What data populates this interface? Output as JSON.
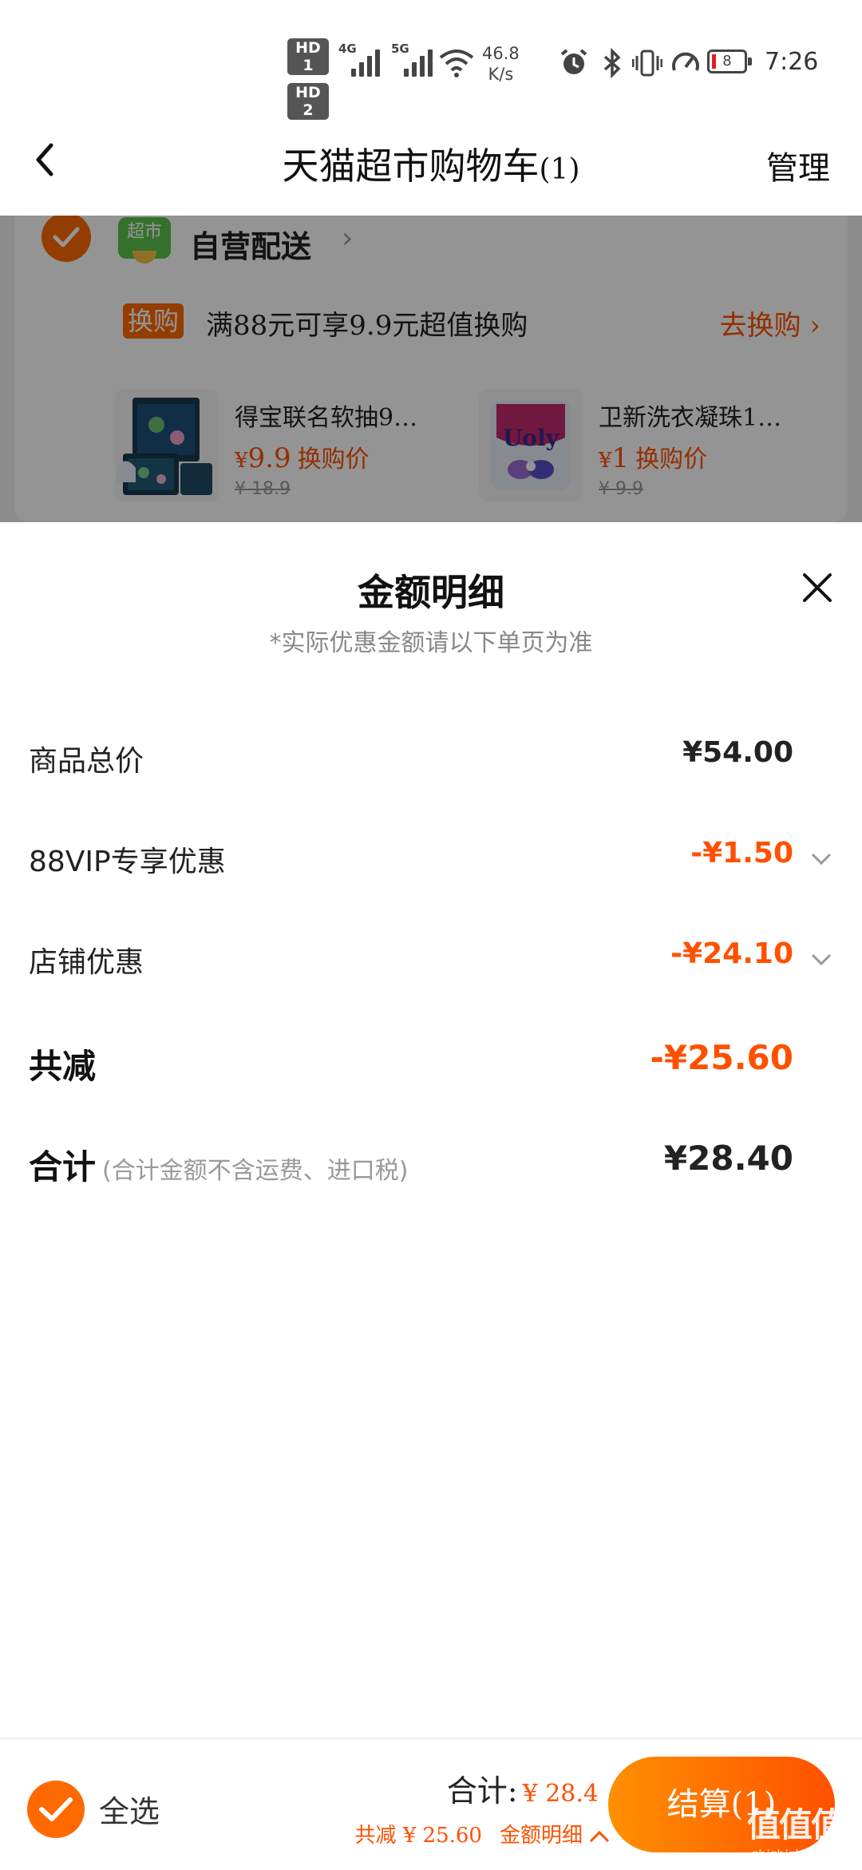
{
  "status_bar": {
    "hd1": "HD 1",
    "hd2": "HD 2",
    "sig1": "4G",
    "sig2": "5G",
    "net_speed_value": "46.8",
    "net_speed_unit": "K/s",
    "battery": "8",
    "time": "7:26",
    "icons": [
      "alarm-icon",
      "bluetooth-icon",
      "vibrate-icon",
      "speedometer-icon"
    ]
  },
  "header": {
    "title": "天猫超市购物车",
    "count": "(1)",
    "manage": "管理"
  },
  "store": {
    "logo_text": "超市",
    "name": "自营配送",
    "promo_tag": "换购",
    "promo_text": "满88元可享9.9元超值换购",
    "promo_link": "去换购",
    "swap_items": [
      {
        "name": "得宝联名软抽9…",
        "currency": "¥",
        "price": "9.9",
        "price_label": "换购价",
        "original": "¥ 18.9"
      },
      {
        "name": "卫新洗衣凝珠1…",
        "currency": "¥",
        "price": "1",
        "price_label": "换购价",
        "original": "¥ 9.9"
      }
    ]
  },
  "sheet": {
    "title": "金额明细",
    "subtitle": "*实际优惠金额请以下单页为准",
    "rows": [
      {
        "label": "商品总价",
        "amount": "¥54.00"
      },
      {
        "label": "88VIP专享优惠",
        "amount": "-¥1.50"
      },
      {
        "label": "店铺优惠",
        "amount": "-¥24.10"
      },
      {
        "label": "共减",
        "amount": "-¥25.60"
      },
      {
        "label": "合计",
        "note": "(合计金额不含运费、进口税)",
        "amount": "¥28.40"
      }
    ]
  },
  "bottom_bar": {
    "select_all": "全选",
    "total_label": "合计:",
    "total_value": "¥ 28.4",
    "saved": "共减 ¥ 25.60",
    "detail_link": "金额明细",
    "checkout": "结算(1)"
  },
  "watermark": {
    "mark": "值值值",
    "url": "zhizhizhi.com"
  },
  "colors": {
    "accent": "#ff5000",
    "accent_gradient_start": "#ff9000",
    "check_orange": "#ff6a00",
    "store_green": "#5cc34e"
  }
}
